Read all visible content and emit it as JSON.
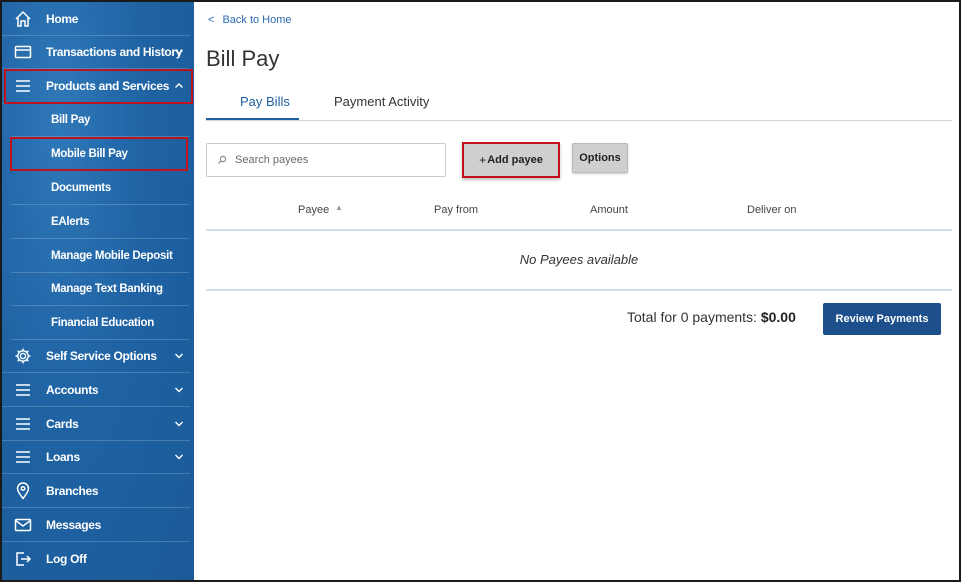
{
  "sidebar": {
    "home": "Home",
    "transactions": "Transactions and History",
    "products": "Products and Services",
    "sub": {
      "bill_pay": "Bill Pay",
      "mobile_bill_pay": "Mobile Bill Pay",
      "documents": "Documents",
      "ealerts": "EAlerts",
      "manage_mobile_deposit": "Manage Mobile Deposit",
      "manage_text_banking": "Manage Text Banking",
      "financial_education": "Financial Education"
    },
    "self_service": "Self Service Options",
    "accounts": "Accounts",
    "cards": "Cards",
    "loans": "Loans",
    "branches": "Branches",
    "messages": "Messages",
    "logoff": "Log Off"
  },
  "main": {
    "back_link": "Back to Home",
    "title": "Bill Pay",
    "tabs": {
      "pay_bills": "Pay Bills",
      "payment_activity": "Payment Activity"
    },
    "search_placeholder": "Search payees",
    "add_payee": "Add payee",
    "options": "Options",
    "columns": {
      "payee": "Payee",
      "pay_from": "Pay from",
      "amount": "Amount",
      "deliver_on": "Deliver on"
    },
    "empty_message": "No Payees available",
    "total_label": "Total for 0 payments:",
    "total_value": "$0.00",
    "review_button": "Review Payments"
  },
  "colors": {
    "sidebar_bg": "#1f63a3",
    "highlight_border": "#c0121c",
    "primary_button": "#1c4f8c",
    "link": "#2a6cb0"
  }
}
